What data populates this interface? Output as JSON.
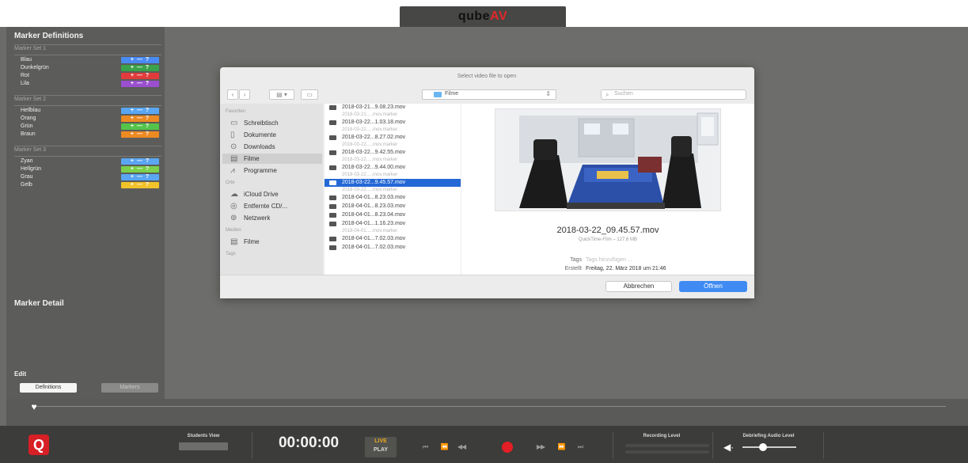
{
  "app": {
    "logo_main": "qube",
    "logo_accent": "AV",
    "q_logo": "Q"
  },
  "sidebar": {
    "title": "Marker Definitions",
    "sets": [
      {
        "name": "Marker Set 1",
        "markers": [
          {
            "label": "Blau",
            "color": "#4a8af4"
          },
          {
            "label": "Dunkelgrün",
            "color": "#3aa24a"
          },
          {
            "label": "Rot",
            "color": "#e23b3b"
          },
          {
            "label": "Lila",
            "color": "#9b4fcf"
          }
        ]
      },
      {
        "name": "Marker Set 2",
        "markers": [
          {
            "label": "Hellblau",
            "color": "#5aa6f2"
          },
          {
            "label": "Orang",
            "color": "#ee8a22"
          },
          {
            "label": "Grün",
            "color": "#55c44a"
          },
          {
            "label": "Braun",
            "color": "#ee8a22"
          }
        ]
      },
      {
        "name": "Marker Set 3",
        "markers": [
          {
            "label": "Zyan",
            "color": "#5aa6f2"
          },
          {
            "label": "Hellgrün",
            "color": "#7cd04a"
          },
          {
            "label": "Grau",
            "color": "#5aa6f2"
          },
          {
            "label": "Gelb",
            "color": "#f2c22a"
          }
        ]
      }
    ],
    "marker_tag_symbols": "+ — ?",
    "marker_detail": "Marker Detail",
    "edit": "Edit",
    "definitions_button": "Definitions",
    "markers_button": "Markers"
  },
  "transport": {
    "students_view_label": "Students View",
    "timecode": "00:00:00",
    "live": "LIVE",
    "play": "PLAY",
    "recording_level_label": "Recording Level",
    "debriefing_audio_label": "Debriefing Audio Level",
    "buttons": [
      "⏮",
      "⏪",
      "◀◀",
      "●",
      "▶▶",
      "⏩",
      "⏭"
    ],
    "audio_level": 0.38
  },
  "dialog": {
    "title": "Select video file to open",
    "location": "Filme",
    "search_placeholder": "Suchen",
    "sidebar_sections": [
      {
        "heading": "Favoriten",
        "items": [
          {
            "label": "Schreibtisch",
            "icon": "desktop-icon",
            "selected": false
          },
          {
            "label": "Dokumente",
            "icon": "document-icon",
            "selected": false
          },
          {
            "label": "Downloads",
            "icon": "download-icon",
            "selected": false
          },
          {
            "label": "Filme",
            "icon": "film-icon",
            "selected": true
          },
          {
            "label": "Programme",
            "icon": "apps-icon",
            "selected": false
          }
        ]
      },
      {
        "heading": "Orte",
        "items": [
          {
            "label": "iCloud Drive",
            "icon": "cloud-icon",
            "selected": false
          },
          {
            "label": "Entfernte CD/...",
            "icon": "disc-icon",
            "selected": false
          },
          {
            "label": "Netzwerk",
            "icon": "network-icon",
            "selected": false
          }
        ]
      },
      {
        "heading": "Medien",
        "items": [
          {
            "label": "Filme",
            "icon": "film-icon",
            "selected": false
          }
        ]
      },
      {
        "heading": "Tags",
        "items": []
      }
    ],
    "files": [
      {
        "name": "2018-03-21...9.08.23.mov",
        "kind": "movie",
        "selected": false
      },
      {
        "name": "2018-03-21.....mov.marker",
        "kind": "marker",
        "selected": false
      },
      {
        "name": "2018-03-22...1.03.18.mov",
        "kind": "movie",
        "selected": false
      },
      {
        "name": "2018-03-22.....mov.marker",
        "kind": "marker",
        "selected": false
      },
      {
        "name": "2018-03-22...8.27.02.mov",
        "kind": "movie",
        "selected": false
      },
      {
        "name": "2018-03-22.....mov.marker",
        "kind": "marker",
        "selected": false
      },
      {
        "name": "2018-03-22...9.42.55.mov",
        "kind": "movie",
        "selected": false
      },
      {
        "name": "2018-03-22.....mov.marker",
        "kind": "marker",
        "selected": false
      },
      {
        "name": "2018-03-22...9.44.00.mov",
        "kind": "movie",
        "selected": false
      },
      {
        "name": "2018-03-22.....mov.marker",
        "kind": "marker",
        "selected": false
      },
      {
        "name": "2018-03-22...9.45.57.mov",
        "kind": "movie",
        "selected": true
      },
      {
        "name": "2018-03-22.....mov.marker",
        "kind": "marker",
        "selected": false
      },
      {
        "name": "2018-04-01...8.23.03.mov",
        "kind": "movie",
        "selected": false
      },
      {
        "name": "2018-04-01...8.23.03.mov",
        "kind": "movie",
        "selected": false
      },
      {
        "name": "2018-04-01...8.23.04.mov",
        "kind": "movie",
        "selected": false
      },
      {
        "name": "2018-04-01...1.16.23.mov",
        "kind": "movie",
        "selected": false
      },
      {
        "name": "2018-04-01.....mov.marker",
        "kind": "marker",
        "selected": false
      },
      {
        "name": "2018-04-01...7.02.03.mov",
        "kind": "movie",
        "selected": false
      },
      {
        "name": "2018-04-01...7.02.03.mov",
        "kind": "movie",
        "selected": false
      }
    ],
    "preview": {
      "filename": "2018-03-22_09.45.57.mov",
      "type": "QuickTime-Film – 127,6 MB",
      "tags_label": "Tags",
      "tags_value": "Tags hinzufügen ...",
      "created_label": "Erstellt",
      "created_value": "Freitag, 22. März 2018 um 21:46"
    },
    "cancel": "Abbrechen",
    "open": "Öffnen"
  }
}
